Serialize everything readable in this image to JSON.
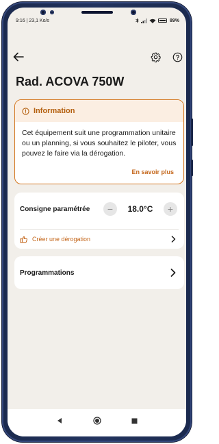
{
  "status_bar": {
    "time_speed": "9:16 | 23,1 Ko/s",
    "battery": "89%"
  },
  "header": {
    "back_icon": "arrow-left-icon",
    "settings_icon": "gear-icon",
    "help_icon": "help-circle-icon"
  },
  "page": {
    "title": "Rad. ACOVA 750W"
  },
  "info_card": {
    "heading": "Information",
    "body": "Cet équipement suit une programmation unitaire ou un planning, si vous souhaitez le piloter, vous pouvez le faire via la dérogation.",
    "link": "En savoir plus",
    "accent_color": "#d4771f"
  },
  "setpoint": {
    "label": "Consigne paramétrée",
    "value": "18.0°C",
    "minus": "−",
    "plus": "+",
    "derogation_label": "Créer une dérogation"
  },
  "programs": {
    "label": "Programmations"
  },
  "nav": {
    "back": "nav-back-icon",
    "home": "nav-home-icon",
    "recents": "nav-recents-icon"
  }
}
